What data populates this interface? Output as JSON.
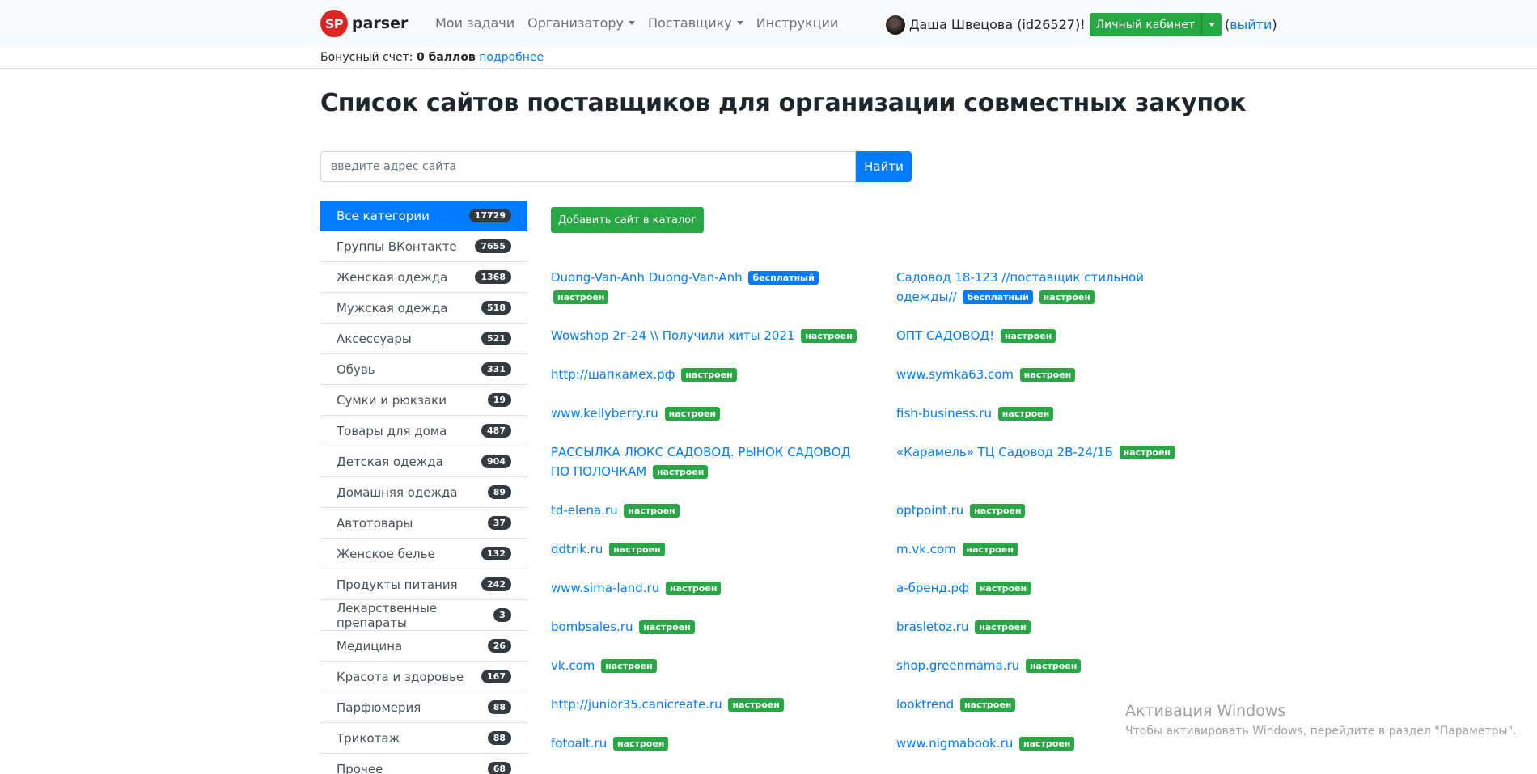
{
  "navbar": {
    "logo_text": "SP",
    "brand": "parser",
    "links": [
      {
        "label": "Мои задачи",
        "dropdown": false
      },
      {
        "label": "Организатору",
        "dropdown": true
      },
      {
        "label": "Поставщику",
        "dropdown": true
      },
      {
        "label": "Инструкции",
        "dropdown": false
      }
    ],
    "user_name": "Даша Швецова (id26527)!",
    "cabinet_label": "Личный кабинет",
    "logout_open": "(",
    "logout_label": "выйти",
    "logout_close": ")"
  },
  "bonus": {
    "prefix": "Бонусный счет:",
    "value": "0 баллов",
    "link": "подробнее"
  },
  "page_title": "Список сайтов поставщиков для организации совместных закупок",
  "search": {
    "placeholder": "введите адрес сайта",
    "button_label": "Найти"
  },
  "categories": [
    {
      "label": "Все категории",
      "count": "17729",
      "active": true
    },
    {
      "label": "Группы ВКонтакте",
      "count": "7655"
    },
    {
      "label": "Женская одежда",
      "count": "1368"
    },
    {
      "label": "Мужская одежда",
      "count": "518"
    },
    {
      "label": "Аксессуары",
      "count": "521"
    },
    {
      "label": "Обувь",
      "count": "331"
    },
    {
      "label": "Сумки и рюкзаки",
      "count": "19"
    },
    {
      "label": "Товары для дома",
      "count": "487"
    },
    {
      "label": "Детская одежда",
      "count": "904"
    },
    {
      "label": "Домашняя одежда",
      "count": "89"
    },
    {
      "label": "Автотовары",
      "count": "37"
    },
    {
      "label": "Женское белье",
      "count": "132"
    },
    {
      "label": "Продукты питания",
      "count": "242"
    },
    {
      "label": "Лекарственные препараты",
      "count": "3"
    },
    {
      "label": "Медицина",
      "count": "26"
    },
    {
      "label": "Красота и здоровье",
      "count": "167"
    },
    {
      "label": "Парфюмерия",
      "count": "88"
    },
    {
      "label": "Трикотаж",
      "count": "88"
    },
    {
      "label": "Прочее",
      "count": "68"
    }
  ],
  "add_site_label": "Добавить сайт в каталог",
  "tags": {
    "free": "бесплатный",
    "configured": "настроен"
  },
  "sites": [
    {
      "name": "Duong-Van-Anh Duong-Van-Anh",
      "free": true
    },
    {
      "name": "Садовод 18-123 //поставщик стильной одежды//",
      "free": true
    },
    {
      "name": "Wowshop 2г-24 \\\\ Получили хиты 2021"
    },
    {
      "name": "ОПТ САДОВОД!"
    },
    {
      "name": "http://шапкамех.рф"
    },
    {
      "name": "www.symka63.com"
    },
    {
      "name": "www.kellyberry.ru"
    },
    {
      "name": "fish-business.ru"
    },
    {
      "name": "РАССЫЛКА ЛЮКС САДОВОД. РЫНОК САДОВОД ПО ПОЛОЧКАМ"
    },
    {
      "name": "«Карамель» ТЦ Садовод 2В-24/1Б"
    },
    {
      "name": "td-elena.ru"
    },
    {
      "name": "optpoint.ru"
    },
    {
      "name": "ddtrik.ru"
    },
    {
      "name": "m.vk.com"
    },
    {
      "name": "www.sima-land.ru"
    },
    {
      "name": "а-бренд.рф"
    },
    {
      "name": "bombsales.ru"
    },
    {
      "name": "brasletoz.ru"
    },
    {
      "name": "vk.com"
    },
    {
      "name": "shop.greenmama.ru"
    },
    {
      "name": "http://junior35.canicreate.ru"
    },
    {
      "name": "looktrend"
    },
    {
      "name": "fotoalt.ru"
    },
    {
      "name": "www.nigmabook.ru"
    }
  ],
  "watermark": {
    "title": "Активация Windows",
    "text": "Чтобы активировать Windows, перейдите в раздел \"Параметры\"."
  },
  "colors": {
    "primary": "#007bff",
    "success": "#28a745",
    "dark": "#343a40",
    "logo": "#e02424"
  }
}
